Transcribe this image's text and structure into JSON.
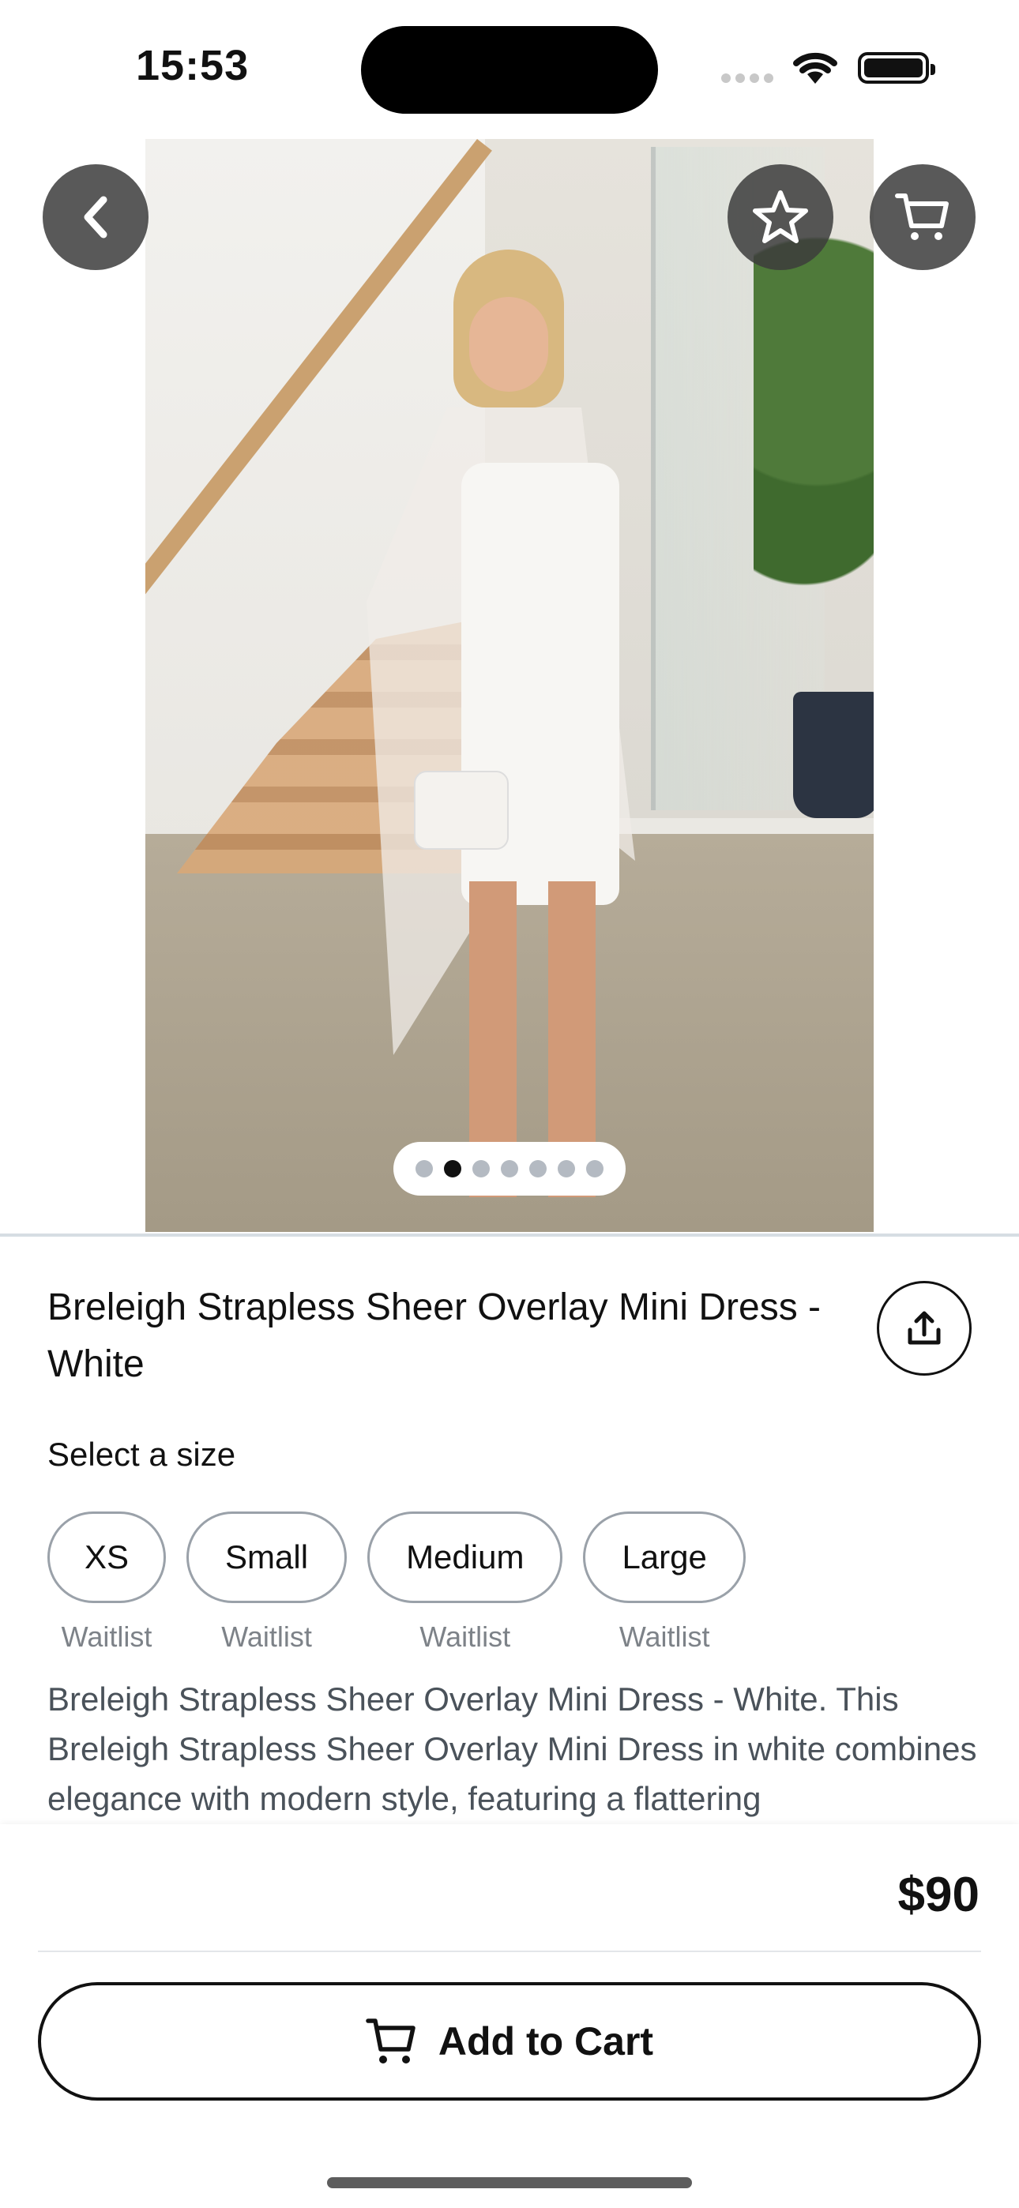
{
  "status_bar": {
    "time": "15:53"
  },
  "product": {
    "title": "Breleigh Strapless Sheer Overlay Mini Dress - White",
    "image_pages": 7,
    "image_active_index": 1,
    "size_label": "Select a size",
    "sizes": [
      {
        "label": "XS",
        "status": "Waitlist"
      },
      {
        "label": "Small",
        "status": "Waitlist"
      },
      {
        "label": "Medium",
        "status": "Waitlist"
      },
      {
        "label": "Large",
        "status": "Waitlist"
      }
    ],
    "description": "Breleigh Strapless Sheer Overlay Mini Dress - White. This Breleigh Strapless Sheer Overlay Mini Dress in white combines elegance with modern style, featuring a flattering"
  },
  "icons": {
    "back": "chevron-left-icon",
    "favorite": "star-icon",
    "cart": "cart-icon",
    "share": "share-icon"
  },
  "bottom_bar": {
    "price": "$90",
    "add_to_cart": "Add to Cart"
  }
}
